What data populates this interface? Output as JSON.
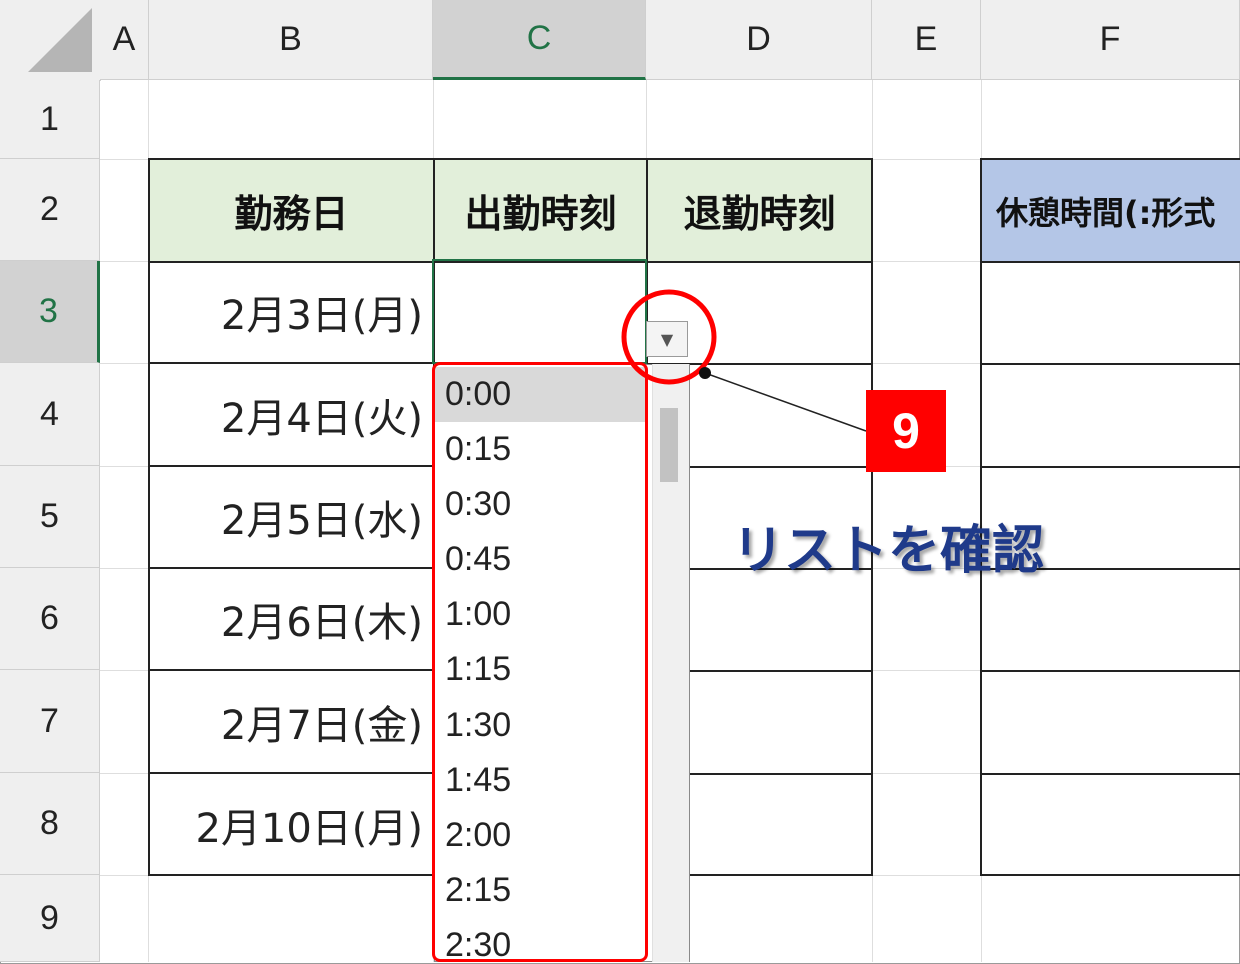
{
  "columns": [
    "A",
    "B",
    "C",
    "D",
    "E",
    "F"
  ],
  "rows": [
    "1",
    "2",
    "3",
    "4",
    "5",
    "6",
    "7",
    "8",
    "9"
  ],
  "table": {
    "headers": [
      "勤務日",
      "出勤時刻",
      "退勤時刻"
    ],
    "dates": [
      "2月3日(月)",
      "2月4日(火)",
      "2月5日(水)",
      "2月6日(木)",
      "2月7日(金)",
      "2月10日(月)"
    ]
  },
  "side_header": "休憩時間(:形式",
  "dropdown": {
    "options": [
      "0:00",
      "0:15",
      "0:30",
      "0:45",
      "1:00",
      "1:15",
      "1:30",
      "1:45",
      "2:00",
      "2:15",
      "2:30"
    ],
    "highlighted": "0:00"
  },
  "annotation": {
    "step_number": "9",
    "note": "リストを確認",
    "color": "#ff0000"
  },
  "colors": {
    "header_green": "#e2efda",
    "header_blue": "#b4c6e7",
    "excel_green": "#217346"
  }
}
